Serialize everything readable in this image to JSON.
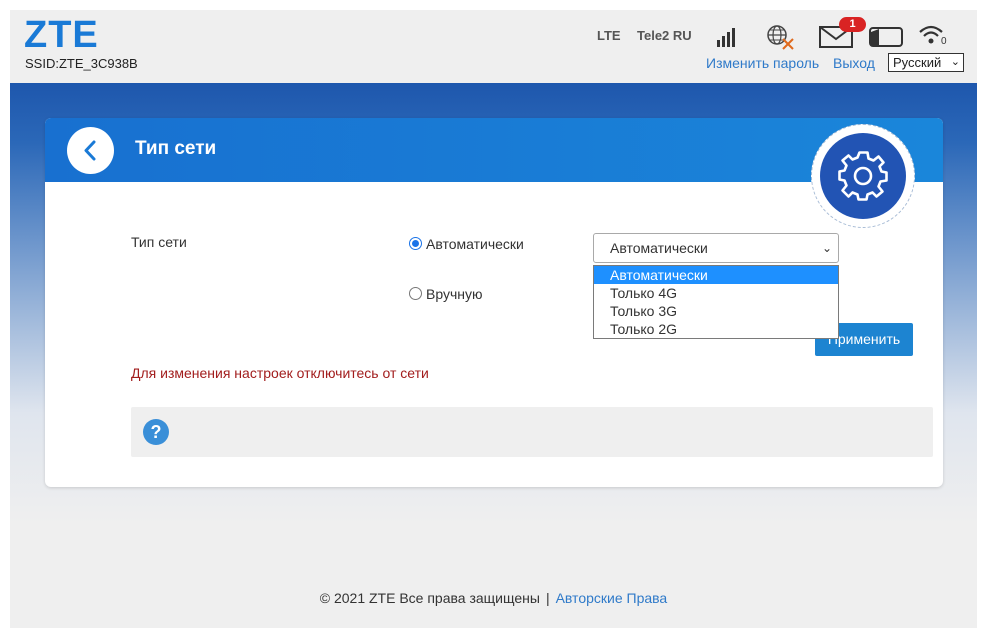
{
  "header": {
    "logo": "ZTE",
    "ssid": "SSID:ZTE_3C938B",
    "network_type": "LTE",
    "carrier": "Tele2 RU",
    "message_count": "1",
    "wifi_clients": "0",
    "change_password": "Изменить пароль",
    "logout": "Выход",
    "language": "Русский",
    "icons": [
      "signal-icon",
      "globe-icon",
      "envelope-icon",
      "battery-icon",
      "wifi-icon"
    ],
    "colors": {
      "link": "#2f7ac9",
      "logo": "#1a7ad6",
      "badge": "#d92323"
    }
  },
  "card": {
    "title": "Тип сети",
    "field_label": "Тип сети",
    "radio_auto": "Автоматически",
    "radio_manual": "Вручную",
    "selected_radio": "Автоматически",
    "select_value": "Автоматически",
    "dropdown_options": [
      "Автоматически",
      "Только 4G",
      "Только 3G",
      "Только 2G"
    ],
    "highlighted_option": "Автоматически",
    "apply_button": "Применить",
    "warning": "Для изменения настроек отключитесь от сети",
    "help_icon": "?",
    "colors": {
      "header": "#1a7ad6",
      "warning": "#a21d1d",
      "button": "#1d84d1",
      "gear": "#2254b4"
    }
  },
  "footer": {
    "copyright": "© 2021 ZTE Все права защищены",
    "separator": "|",
    "copyright_link": "Авторские Права"
  }
}
